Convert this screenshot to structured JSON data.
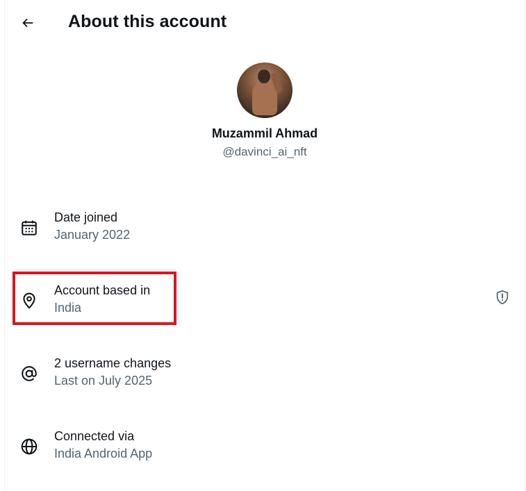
{
  "header": {
    "title": "About this account",
    "back_icon": "arrow-left-icon"
  },
  "profile": {
    "display_name": "Muzammil Ahmad",
    "handle": "@davinci_ai_nft"
  },
  "rows": [
    {
      "icon": "calendar-icon",
      "label": "Date joined",
      "value": "January 2022"
    },
    {
      "icon": "location-pin-icon",
      "label": "Account based in",
      "value": "India"
    },
    {
      "icon": "at-sign-icon",
      "label": "2 username changes",
      "value": "Last on July 2025"
    },
    {
      "icon": "globe-icon",
      "label": "Connected via",
      "value": "India Android App"
    }
  ],
  "colors": {
    "primary_text": "#0f1419",
    "secondary_text": "#536471",
    "highlight": "#e0141f"
  }
}
